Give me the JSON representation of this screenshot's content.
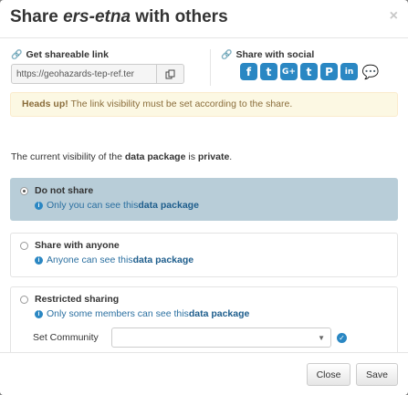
{
  "header": {
    "title_prefix": "Share ",
    "package_name": "ers-etna",
    "title_suffix": " with others",
    "close_glyph": "×"
  },
  "share_link": {
    "label": "Get shareable link",
    "url": "https://geohazards-tep-ref.ter",
    "icon": "link-icon",
    "copy_icon": "copy-icon"
  },
  "share_social": {
    "label": "Share with social",
    "networks": [
      {
        "name": "facebook",
        "glyph": "f"
      },
      {
        "name": "twitter",
        "glyph": "t"
      },
      {
        "name": "google-plus",
        "glyph": "G+"
      },
      {
        "name": "tumblr",
        "glyph": "t"
      },
      {
        "name": "pinterest",
        "glyph": "P"
      },
      {
        "name": "linkedin",
        "glyph": "in"
      },
      {
        "name": "chat",
        "glyph": "💬"
      }
    ]
  },
  "alert": {
    "strong": "Heads up!",
    "text": " The link visibility must be set according to the share."
  },
  "visibility": {
    "prefix": "The current visibility of the ",
    "pkg": "data package",
    "mid": " is ",
    "state": "private",
    "suffix": "."
  },
  "options": [
    {
      "title": "Do not share",
      "desc_prefix": "Only you can see this ",
      "desc_link": "data package",
      "selected": true
    },
    {
      "title": "Share with anyone",
      "desc_prefix": "Anyone can see this ",
      "desc_link": "data package",
      "selected": false
    },
    {
      "title": "Restricted sharing",
      "desc_prefix": "Only some members can see this ",
      "desc_link": "data package",
      "selected": false
    }
  ],
  "community": {
    "label": "Set Community",
    "value": ""
  },
  "footer": {
    "close_label": "Close",
    "save_label": "Save"
  },
  "colors": {
    "accent": "#2a87c3",
    "selected_option": "#b8cdd8",
    "alert_bg": "#fcf8e3",
    "alert_text": "#8a6d3b"
  }
}
